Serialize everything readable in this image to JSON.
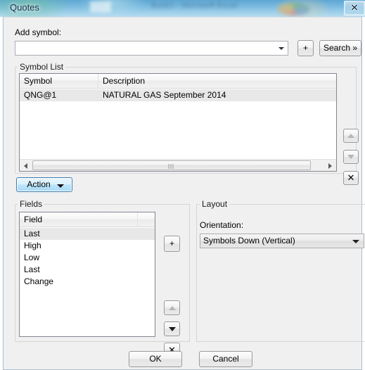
{
  "window": {
    "title": "Quotes",
    "close_icon": "close-icon",
    "background_blur_text": "Book1 - Microsoft Excel"
  },
  "add_symbol": {
    "label": "Add symbol:",
    "value": "",
    "placeholder": "",
    "dropdown_icon": "chevron-down-icon",
    "add_button_label": "+",
    "search_button_label": "Search »"
  },
  "symbol_list": {
    "group_label": "Symbol List",
    "columns": [
      "Symbol",
      "Description"
    ],
    "rows": [
      {
        "symbol": "QNG@1",
        "description": "NATURAL GAS September 2014",
        "selected": true
      }
    ],
    "scrollbar": {
      "left_arrow_icon": "arrow-left-icon",
      "right_arrow_icon": "arrow-right-icon"
    },
    "side_buttons": [
      {
        "name": "move-symbol-up-button",
        "icon": "arrow-up-icon",
        "label": "",
        "disabled": true
      },
      {
        "name": "move-symbol-down-button",
        "icon": "arrow-down-icon",
        "label": "",
        "disabled": true
      },
      {
        "name": "remove-symbol-button",
        "icon": "close-x-icon",
        "label": "✕",
        "disabled": false
      }
    ]
  },
  "action": {
    "label": "Action",
    "dropdown_icon": "chevron-down-icon",
    "focused": true
  },
  "fields": {
    "group_label": "Fields",
    "columns": [
      "Field",
      ""
    ],
    "rows": [
      {
        "field": "Last",
        "selected": true
      },
      {
        "field": "High",
        "selected": false
      },
      {
        "field": "Low",
        "selected": false
      },
      {
        "field": "Last",
        "selected": false
      },
      {
        "field": "Change",
        "selected": false
      }
    ],
    "side_buttons": [
      {
        "name": "add-field-button",
        "icon": "plus-icon",
        "label": "+",
        "disabled": false
      },
      {
        "name": "move-field-up-button",
        "icon": "arrow-up-icon",
        "label": "",
        "disabled": true
      },
      {
        "name": "move-field-down-button",
        "icon": "arrow-down-icon",
        "label": "",
        "disabled": false
      },
      {
        "name": "remove-field-button",
        "icon": "close-x-icon",
        "label": "✕",
        "disabled": false
      }
    ]
  },
  "layout": {
    "group_label": "Layout",
    "orientation_label": "Orientation:",
    "orientation_value": "Symbols Down (Vertical)",
    "orientation_dropdown_icon": "chevron-down-icon"
  },
  "footer": {
    "ok_label": "OK",
    "cancel_label": "Cancel"
  },
  "colors": {
    "dialog_background": "#f0f0f0",
    "accent_focus": "#3c7fb1",
    "list_selection": "#e8e8e8",
    "control_border": "#828790",
    "titlebar_glass": "#78b9df"
  }
}
